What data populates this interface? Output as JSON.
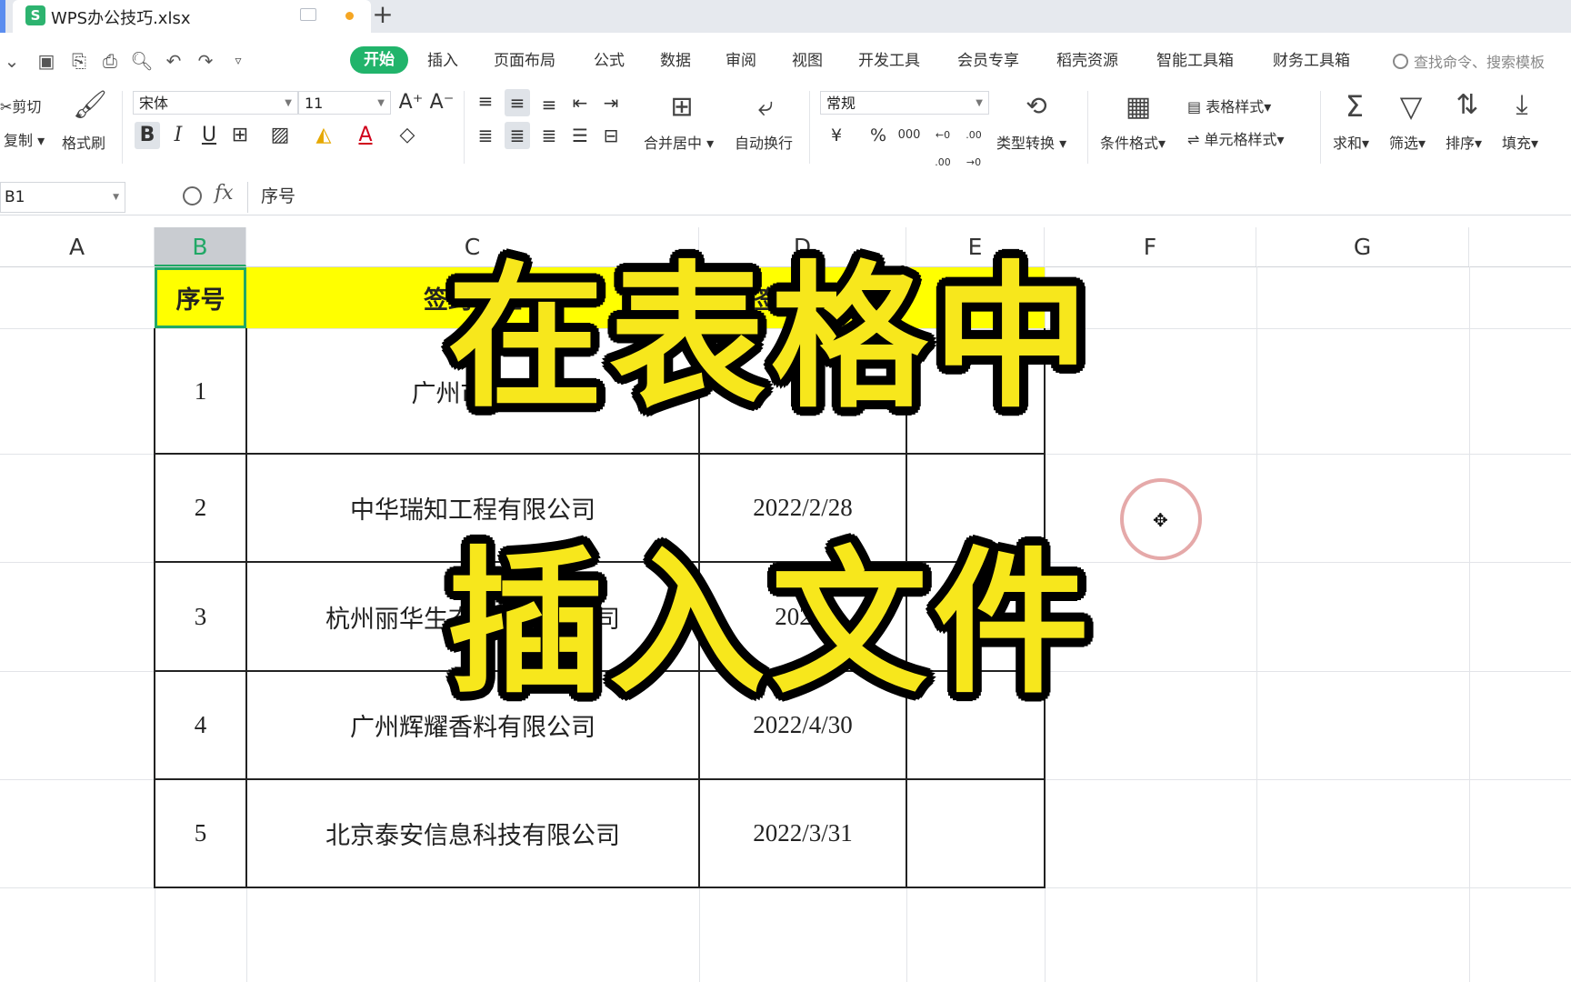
{
  "tab": {
    "title": "WPS办公技巧.xlsx",
    "app_icon": "S"
  },
  "menu": {
    "items": [
      "开始",
      "插入",
      "页面布局",
      "公式",
      "数据",
      "审阅",
      "视图",
      "开发工具",
      "会员专享",
      "稻壳资源",
      "智能工具箱",
      "财务工具箱"
    ],
    "search_placeholder": "查找命令、搜索模板"
  },
  "ribbon": {
    "cut": "剪切",
    "copy": "复制",
    "format_painter": "格式刷",
    "font_name": "宋体",
    "font_size": "11",
    "merge_center": "合并居中",
    "wrap_text": "自动换行",
    "number_format": "常规",
    "type_convert": "类型转换",
    "conditional_format": "条件格式",
    "table_style": "表格样式",
    "cell_style": "单元格样式",
    "sum": "求和",
    "filter": "筛选",
    "sort": "排序",
    "fill": "填充",
    "currency": "¥",
    "percent": "%",
    "thousands": "000",
    "inc_decimal": "←0 .00",
    "dec_decimal": ".00 →0"
  },
  "formula_bar": {
    "name_box": "B1",
    "fx": "fx",
    "value": "序号"
  },
  "columns": [
    "A",
    "B",
    "C",
    "D",
    "E",
    "F",
    "G"
  ],
  "table": {
    "header": [
      "序号",
      "签约单位",
      "签约日期",
      ""
    ],
    "rows": [
      {
        "no": "1",
        "company": "广州市天河",
        "date": ""
      },
      {
        "no": "2",
        "company": "中华瑞知工程有限公司",
        "date": "2022/2/28"
      },
      {
        "no": "3",
        "company": "杭州丽华生态科技有限公司",
        "date": "2022/"
      },
      {
        "no": "4",
        "company": "广州辉耀香料有限公司",
        "date": "2022/4/30"
      },
      {
        "no": "5",
        "company": "北京泰安信息科技有限公司",
        "date": "2022/3/31"
      }
    ]
  },
  "overlay": {
    "line1": "在表格中",
    "line2": "插入文件"
  },
  "colors": {
    "accent": "#21b46b",
    "header_fill": "#ffff00",
    "overlay_text": "#f7e71c"
  }
}
